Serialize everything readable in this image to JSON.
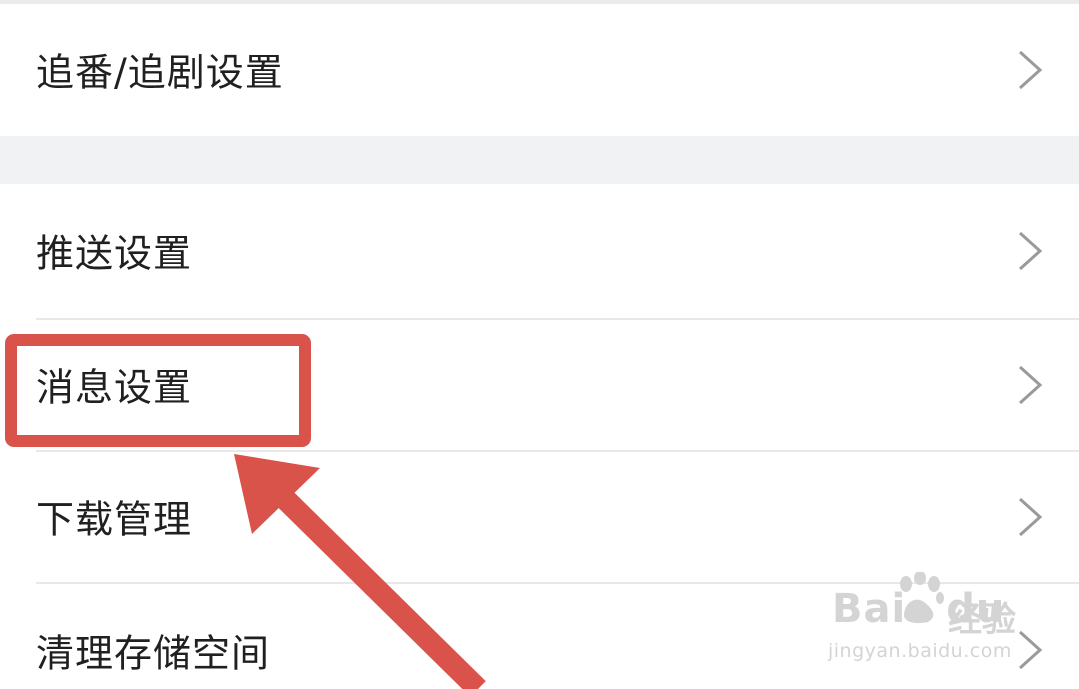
{
  "settings_list": {
    "rows": [
      {
        "label": "追番/追剧设置"
      },
      {
        "label": "推送设置"
      },
      {
        "label": "消息设置"
      },
      {
        "label": "下载管理"
      },
      {
        "label": "清理存储空间"
      }
    ],
    "chevron_icon": "chevron-right-icon"
  },
  "annotation": {
    "highlight_color": "#d9534a",
    "highlighted_row": "消息设置",
    "arrow_icon": "arrow-up-left-icon"
  },
  "watermark": {
    "logo": "Bai",
    "logo_suffix": "du",
    "product": "经验",
    "url": "jingyan.baidu.com"
  }
}
